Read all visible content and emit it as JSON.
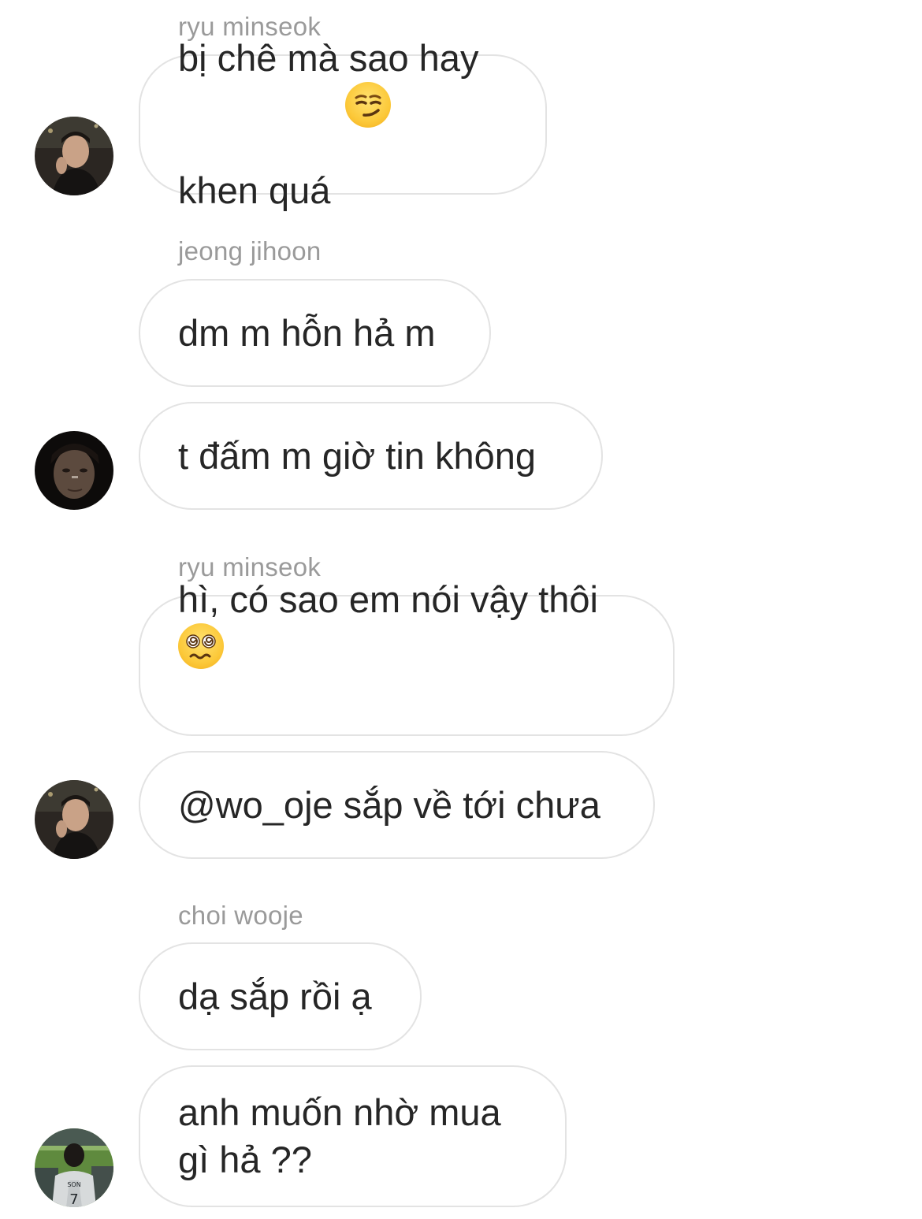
{
  "messages": [
    {
      "sender": "ryu minseok",
      "text": "bị chê mà sao hay\nkhen quá",
      "emoji": "smirk-emoji",
      "avatar": "ryu-minseok-avatar"
    },
    {
      "sender": "jeong jihoon",
      "text": "dm m hỗn hả m"
    },
    {
      "text": "t đấm m giờ tin không",
      "avatar": "jeong-jihoon-avatar"
    },
    {
      "sender": "ryu minseok",
      "text": "hì, có sao em nói vậy thôi",
      "emoji": "dizzy-face-emoji"
    },
    {
      "text": "@wo_oje sắp về tới chưa",
      "avatar": "ryu-minseok-avatar"
    },
    {
      "sender": "choi wooje",
      "text": "dạ sắp rồi ạ"
    },
    {
      "text": "anh muốn nhờ mua\ngì hả ??",
      "avatar": "choi-wooje-avatar"
    }
  ],
  "colors": {
    "bubble_border": "#e3e3e3",
    "sender_text": "#9a9a9a",
    "message_text": "#262626"
  }
}
